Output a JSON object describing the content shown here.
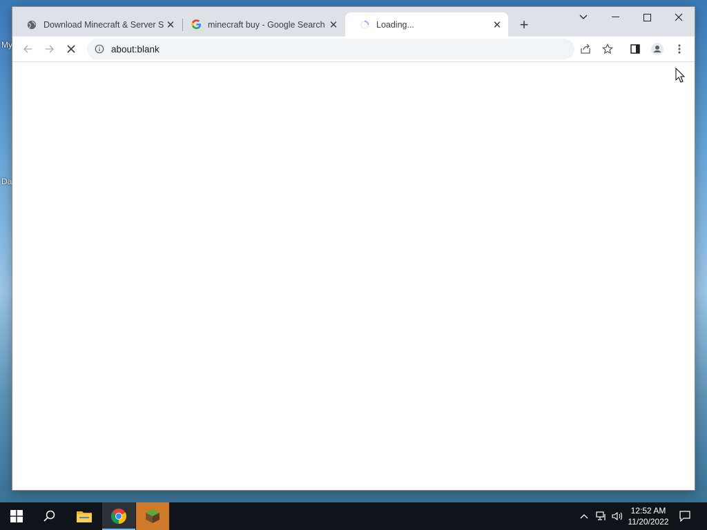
{
  "desktop": {
    "label1": "My",
    "label2": "Da"
  },
  "browser": {
    "tabs": [
      {
        "title": "Download Minecraft & Server Sc",
        "favicon": "globe-icon",
        "active": false
      },
      {
        "title": "minecraft buy - Google Search",
        "favicon": "google-icon",
        "active": false
      },
      {
        "title": "Loading...",
        "favicon": "loading-spinner-icon",
        "active": true
      }
    ],
    "new_tab_label": "+",
    "address": "about:blank",
    "accent": "#1a73e8"
  },
  "taskbar": {
    "time": "12:52 AM",
    "date": "11/20/2022",
    "apps": [
      "start-icon",
      "search-icon",
      "file-explorer-icon",
      "chrome-icon",
      "minecraft-icon"
    ]
  }
}
